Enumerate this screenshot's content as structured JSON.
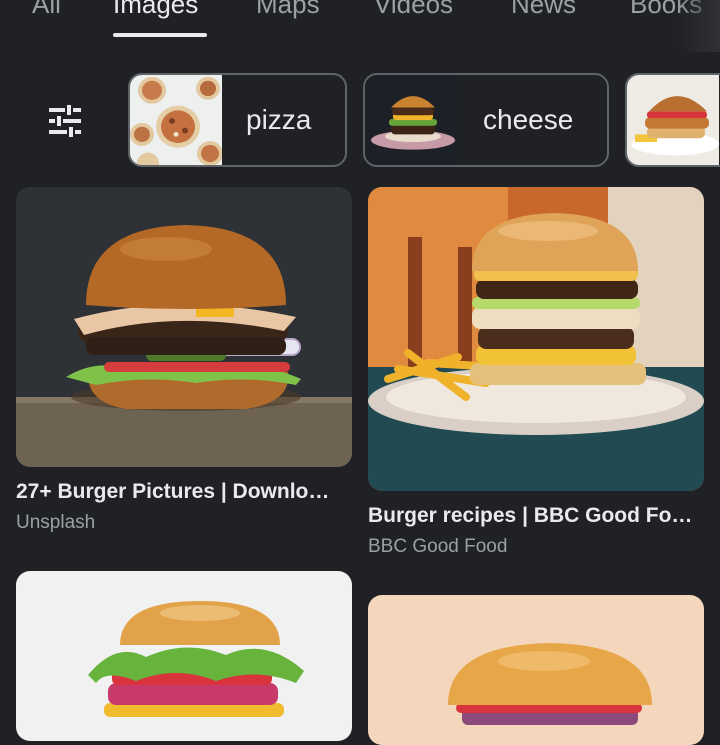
{
  "tabs": [
    {
      "label": "All",
      "active": false
    },
    {
      "label": "Images",
      "active": true
    },
    {
      "label": "Maps",
      "active": false
    },
    {
      "label": "Videos",
      "active": false
    },
    {
      "label": "News",
      "active": false
    },
    {
      "label": "Books",
      "active": false
    }
  ],
  "filter_icon": "tune-icon",
  "chips": [
    {
      "label": "pizza"
    },
    {
      "label": "cheese"
    },
    {
      "label": ""
    }
  ],
  "results": [
    {
      "title": "27+ Burger Pictures | Downlo…",
      "source": "Unsplash"
    },
    {
      "title": "Burger recipes | BBC Good Fo…",
      "source": "BBC Good Food"
    },
    {
      "title": "",
      "source": ""
    },
    {
      "title": "",
      "source": ""
    }
  ],
  "colors": {
    "background": "#202124",
    "text_primary": "#e8eaed",
    "text_secondary": "#9aa0a6",
    "chip_border": "#5f6368"
  }
}
